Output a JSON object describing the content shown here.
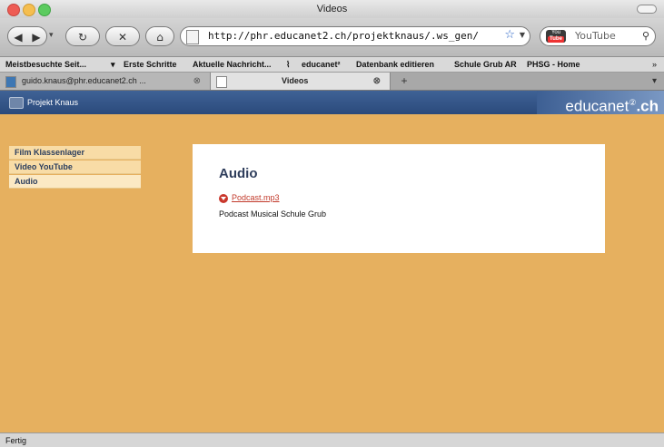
{
  "window": {
    "title": "Videos"
  },
  "toolbar": {
    "url": "http://phr.educanet2.ch/projektknaus/.ws_gen/",
    "search_placeholder": "YouTube"
  },
  "bookmarks": [
    "Meistbesuchte Seit...",
    "Erste Schritte",
    "Aktuelle Nachricht...",
    "educanet²",
    "Datenbank editieren",
    "Schule Grub AR",
    "PHSG - Home"
  ],
  "tabs": [
    {
      "label": "guido.knaus@phr.educanet2.ch ..."
    },
    {
      "label": "Videos"
    }
  ],
  "site": {
    "name": "Projekt Knaus",
    "logo_main": "educanet",
    "logo_sup": "②",
    "logo_suffix": ".ch"
  },
  "sidebar": {
    "items": [
      {
        "label": "Film Klassenlager"
      },
      {
        "label": "Video YouTube"
      },
      {
        "label": "Audio"
      }
    ]
  },
  "main": {
    "heading": "Audio",
    "link_text": "Podcast.mp3",
    "description": "Podcast Musical Schule Grub"
  },
  "status": {
    "text": "Fertig"
  }
}
